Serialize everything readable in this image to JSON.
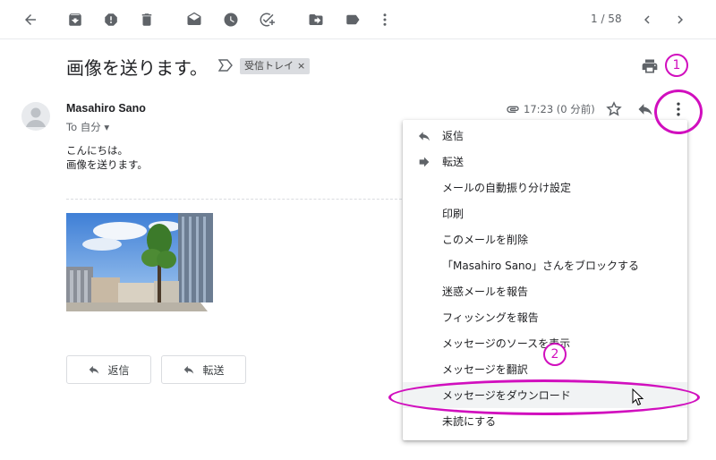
{
  "toolbar": {
    "icons": [
      "back-arrow-icon",
      "archive-icon",
      "report-spam-icon",
      "delete-icon",
      "mark-unread-icon",
      "snooze-icon",
      "add-task-icon",
      "move-to-icon",
      "label-icon",
      "more-vert-icon"
    ],
    "page_counter": "1 / 58",
    "prev_icon": "chevron-left-icon",
    "next_icon": "chevron-right-icon"
  },
  "email": {
    "subject": "画像を送ります。",
    "label": "受信トレイ",
    "label_close": "×",
    "sender": "Masahiro Sano",
    "to_line": "To 自分 ▾",
    "time": "17:23 (0 分前)",
    "body_lines": [
      "こんにちは。",
      "画像を送ります。"
    ]
  },
  "actions": {
    "reply_label": "返信",
    "forward_label": "転送"
  },
  "menu": {
    "items": [
      {
        "label": "返信",
        "icon": "reply-icon"
      },
      {
        "label": "転送",
        "icon": "forward-icon"
      },
      {
        "label": "メールの自動振り分け設定",
        "icon": ""
      },
      {
        "label": "印刷",
        "icon": ""
      },
      {
        "label": "このメールを削除",
        "icon": ""
      },
      {
        "label": "「Masahiro Sano」さんをブロックする",
        "icon": ""
      },
      {
        "label": "迷惑メールを報告",
        "icon": ""
      },
      {
        "label": "フィッシングを報告",
        "icon": ""
      },
      {
        "label": "メッセージのソースを表示",
        "icon": ""
      },
      {
        "label": "メッセージを翻訳",
        "icon": ""
      },
      {
        "label": "メッセージをダウンロード",
        "icon": ""
      },
      {
        "label": "未読にする",
        "icon": ""
      }
    ]
  },
  "annotations": {
    "step1": "1",
    "step2": "2",
    "color": "#d10fbe"
  }
}
